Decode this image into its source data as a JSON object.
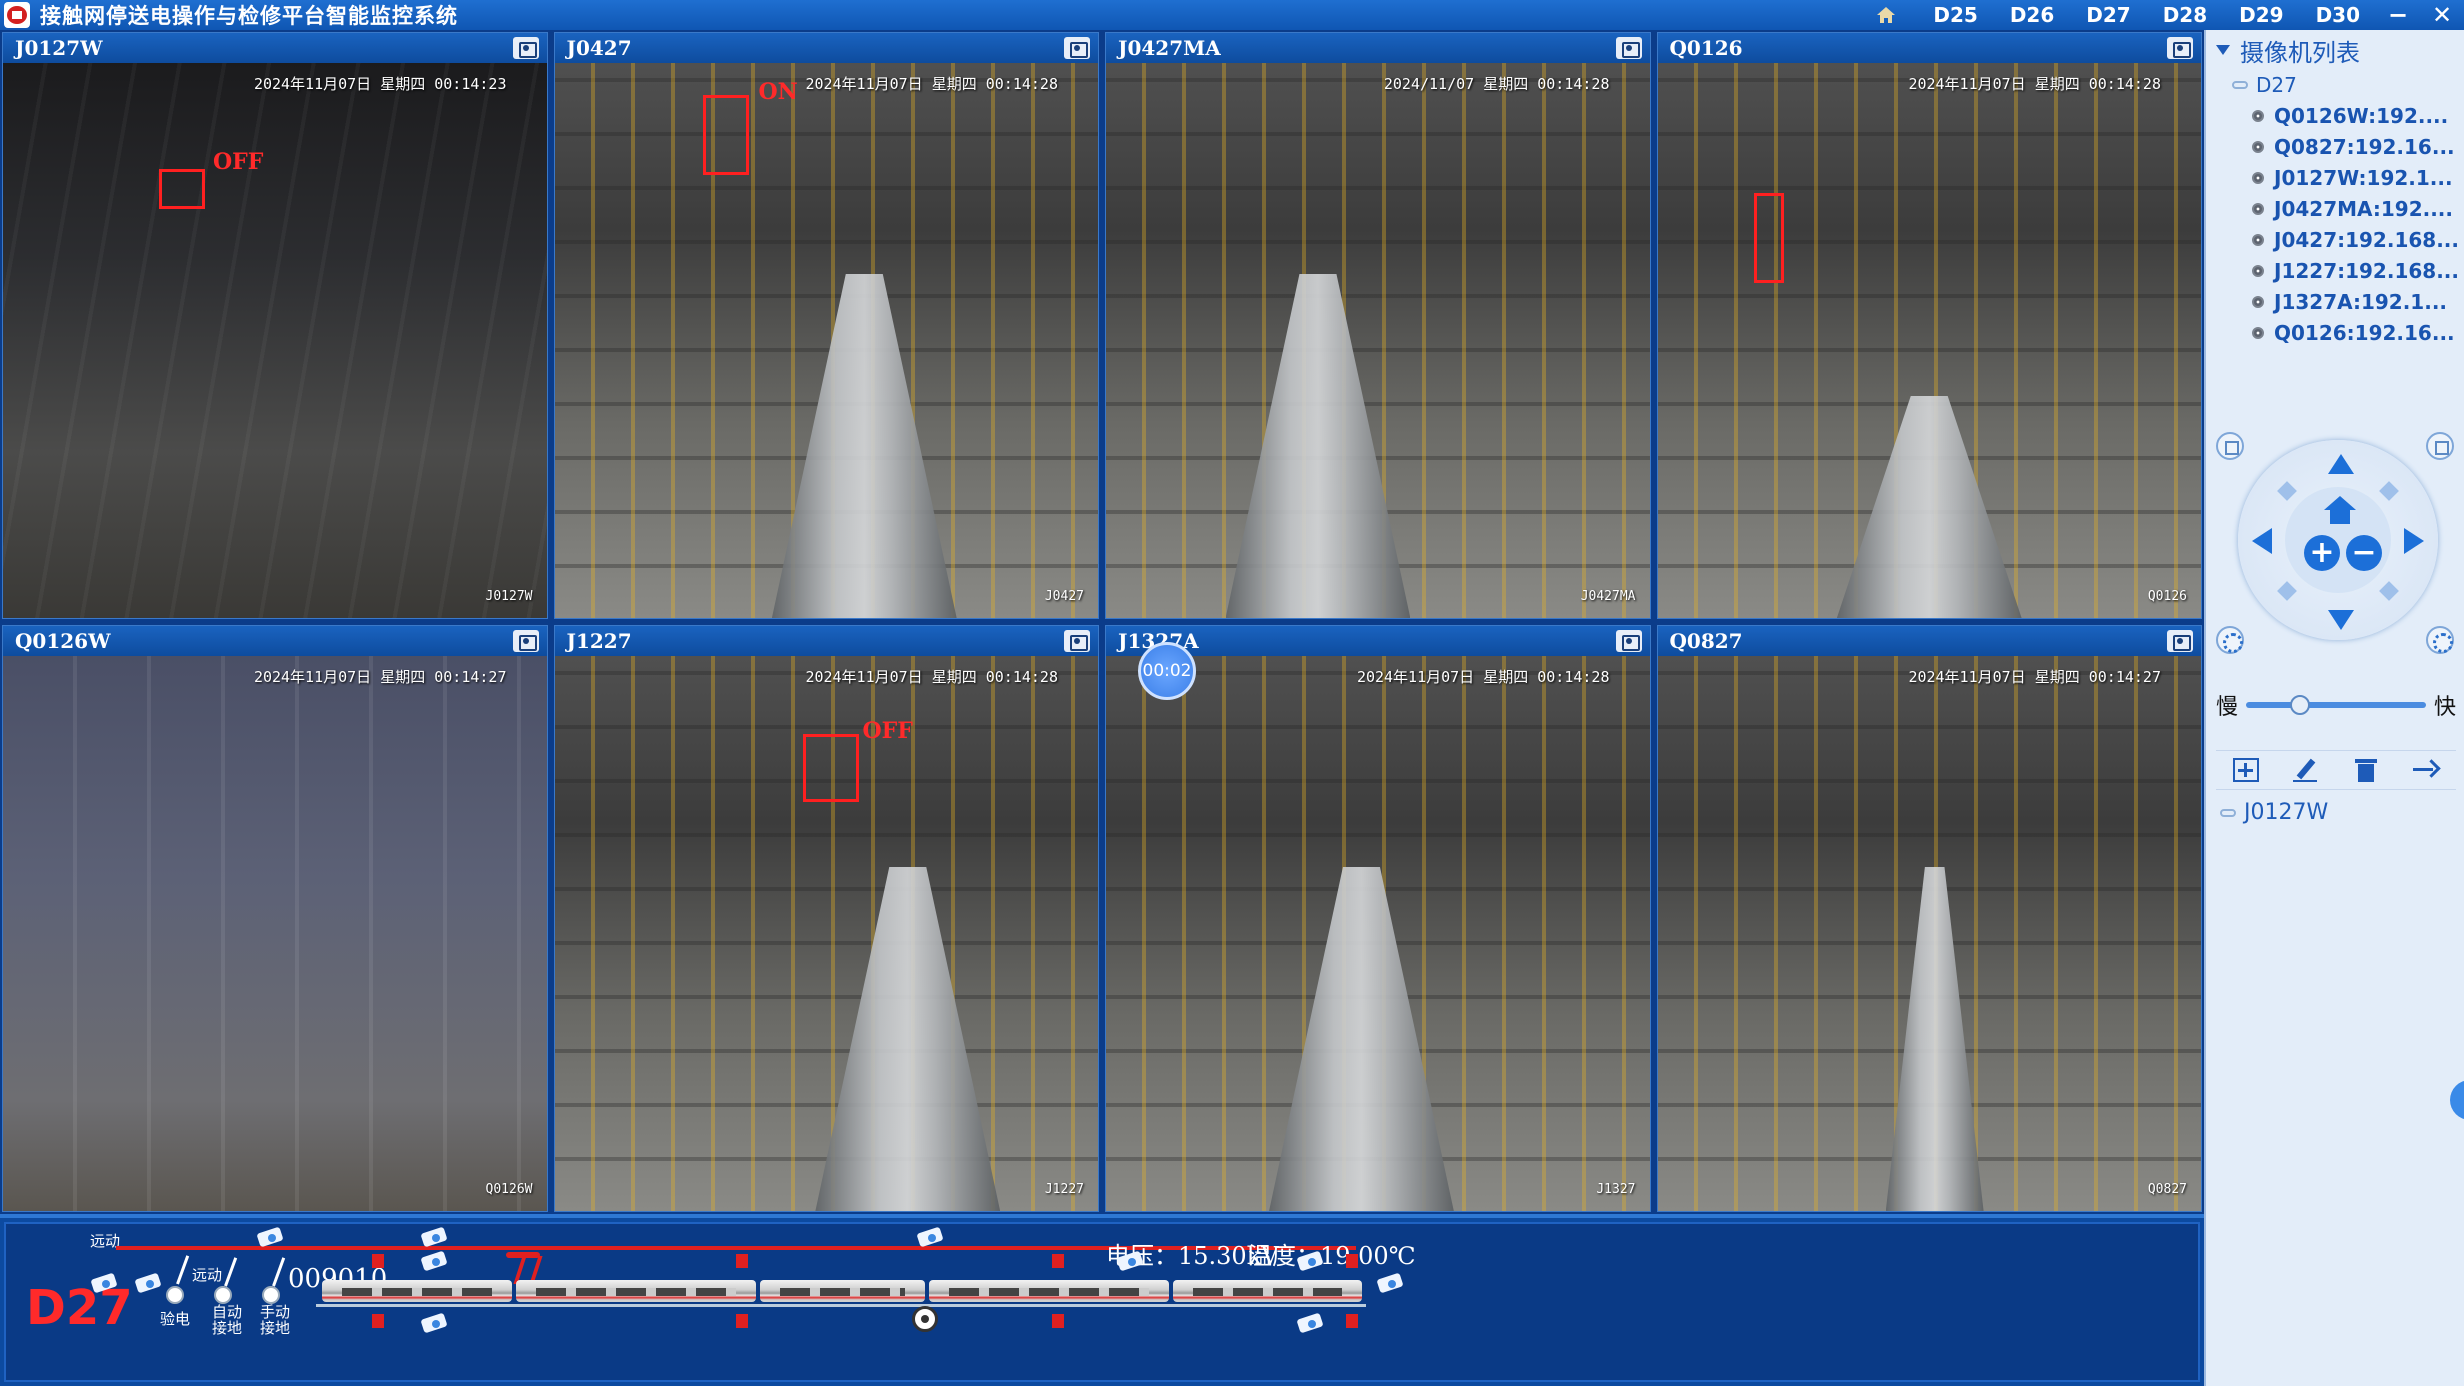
{
  "window": {
    "title": "接触网停送电操作与检修平台智能监控系统",
    "station_tabs": [
      "D25",
      "D26",
      "D27",
      "D28",
      "D29",
      "D30"
    ],
    "min_label": "−",
    "close_label": "✕"
  },
  "cameras": [
    {
      "name": "J0127W",
      "timestamp": "2024年11月07日 星期四 00:14:23",
      "corner_id": "J0127W",
      "detect_label": "OFF"
    },
    {
      "name": "J0427",
      "timestamp": "2024年11月07日 星期四 00:14:28",
      "corner_id": "J0427",
      "detect_label": "ON"
    },
    {
      "name": "J0427MA",
      "timestamp": "2024/11/07 星期四 00:14:28",
      "corner_id": "J0427MA"
    },
    {
      "name": "Q0126",
      "timestamp": "2024年11月07日 星期四 00:14:28",
      "corner_id": "Q0126"
    },
    {
      "name": "Q0126W",
      "timestamp": "2024年11月07日 星期四 00:14:27",
      "corner_id": "Q0126W"
    },
    {
      "name": "J1227",
      "timestamp": "2024年11月07日 星期四 00:14:28",
      "corner_id": "J1227",
      "detect_label": "OFF"
    },
    {
      "name": "J1327A",
      "timestamp": "2024年11月07日 星期四 00:14:28",
      "corner_id": "J1327",
      "rec_badge": "00:02"
    },
    {
      "name": "Q0827",
      "timestamp": "2024年11月07日 星期四 00:14:27",
      "corner_id": "Q0827"
    }
  ],
  "side_panel": {
    "title": "摄像机列表",
    "group": "D27",
    "camera_list": [
      "Q0126W:192....",
      "Q0827:192.16...",
      "J0127W:192.1...",
      "J0427MA:192....",
      "J0427:192.168...",
      "J1227:192.168...",
      "J1327A:192.1...",
      "Q0126:192.16..."
    ],
    "speed_slow": "慢",
    "speed_fast": "快",
    "speed_level": 0.3,
    "preset_item": "J0127W"
  },
  "status_bar": {
    "station": "D27",
    "remote_label_1": "远动",
    "remote_label_2": "远动",
    "switch_labels": [
      "验电",
      "自动\n接地",
      "手动\n接地"
    ],
    "train_code": "009010",
    "voltage": "电压：15.30kV",
    "temperature": "温度：19.00℃"
  },
  "colors": {
    "accent": "#1c6fd8",
    "alarm": "#e02020",
    "titlebar": "#1f6fd1"
  }
}
